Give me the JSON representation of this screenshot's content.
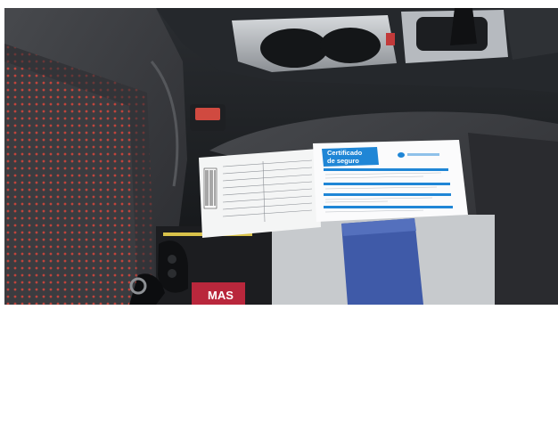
{
  "certificate": {
    "title_line1": "Certificado",
    "title_line2": "de seguro",
    "accent_color": "#1f86d6"
  },
  "card": {
    "brand": "MAS"
  },
  "colors": {
    "seat_fabric": "#3a3b3f",
    "seat_accent_red": "#c8453c",
    "interior_dark": "#17191c",
    "trim_silver": "#a9adb2",
    "folder_blue": "#3f5aa8"
  }
}
